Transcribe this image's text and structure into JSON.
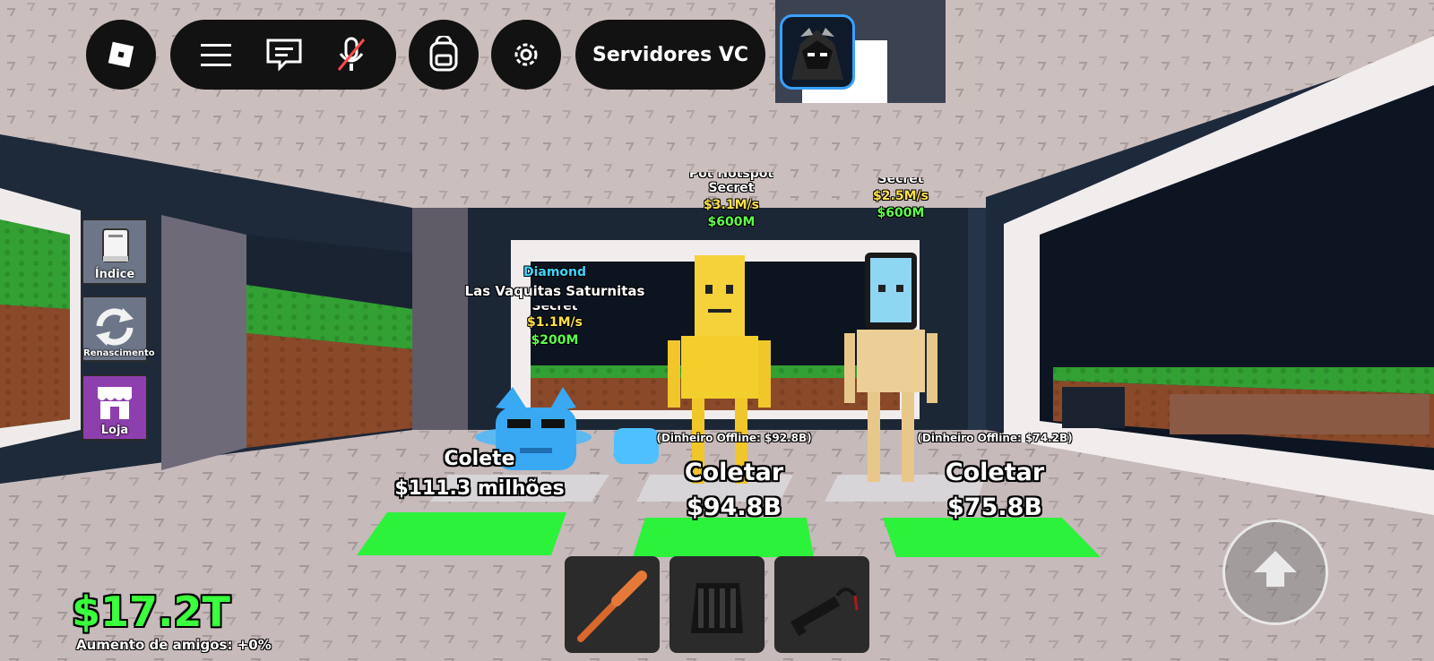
{
  "hud": {
    "voice_button_label": "Servidores VC"
  },
  "side_menu": [
    {
      "label": "Índice",
      "icon": "book-icon"
    },
    {
      "label": "Renascimento",
      "icon": "refresh-icon"
    },
    {
      "label": "Loja",
      "icon": "shop-icon"
    }
  ],
  "brainrots": [
    {
      "rarity_label": "Diamond",
      "name": "Las Vaquitas Saturnitas",
      "tier": "Secret",
      "rate": "$1.1M/s",
      "price": "$200M"
    },
    {
      "rarity_label": "",
      "name": "Pot Hotspot",
      "tier": "Secret",
      "rate": "$3.1M/s",
      "price": "$600M"
    },
    {
      "rarity_label": "",
      "name": "",
      "tier": "Secret",
      "rate": "$2.5M/s",
      "price": "$600M"
    }
  ],
  "collect_pads": [
    {
      "offline": "",
      "action": "Colete",
      "amount": "$111.3 milhões"
    },
    {
      "offline": "(Dinheiro Offline: $92.8B)",
      "action": "Coletar",
      "amount": "$94.8B"
    },
    {
      "offline": "(Dinheiro Offline: $74.2B)",
      "action": "Coletar",
      "amount": "$75.8B"
    }
  ],
  "hotbar": [
    {
      "item": "bat-icon"
    },
    {
      "item": "glove-icon"
    },
    {
      "item": "grapple-gun-icon"
    }
  ],
  "cash": {
    "amount": "$17.2T",
    "friend_boost": "Aumento de amigos: +0%"
  },
  "colors": {
    "cash_green": "#39ff3c",
    "rate_yellow": "#ffe14a",
    "price_green": "#5dff4c",
    "diamond_cyan": "#3fd4ff",
    "pad_green": "#2cf23b",
    "avatar_border": "#3aa0ff"
  }
}
